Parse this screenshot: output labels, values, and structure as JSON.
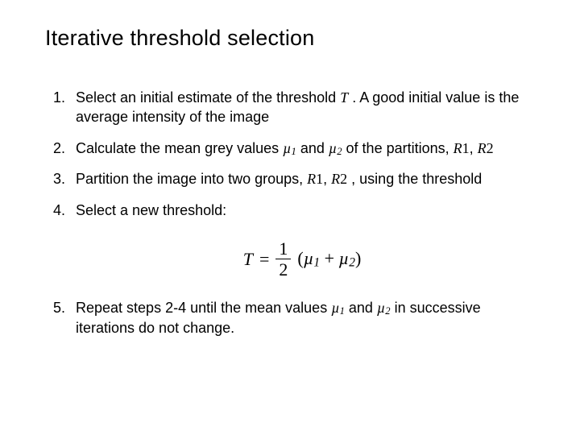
{
  "title": "Iterative threshold selection",
  "symbols": {
    "T": "T",
    "mu1_mu": "µ",
    "mu1_sub": "1",
    "mu2_mu": "µ",
    "mu2_sub": "2",
    "R1": "R",
    "R1_num": "1",
    "R2": "R",
    "R2_num": "2"
  },
  "steps": {
    "s1_a": "Select an initial estimate of the threshold ",
    "s1_b": " . A good initial value is the average intensity of the image",
    "s2_a": "Calculate the mean grey values  ",
    "s2_and": "  and  ",
    "s2_b": " of the partitions, ",
    "s2_sep": ", ",
    "s3_a": "Partition the image into two groups, ",
    "s3_sep": ", ",
    "s3_b": " , using the threshold",
    "s4": " Select a new threshold:",
    "s5_a": "Repeat steps 2-4 until the mean values  ",
    "s5_and": "  and ",
    "s5_b": " in successive iterations do not  change."
  },
  "formula": {
    "lhs": "T",
    "eq": "=",
    "num": "1",
    "den": "2",
    "open": "(",
    "plus": " + ",
    "close": ")"
  }
}
